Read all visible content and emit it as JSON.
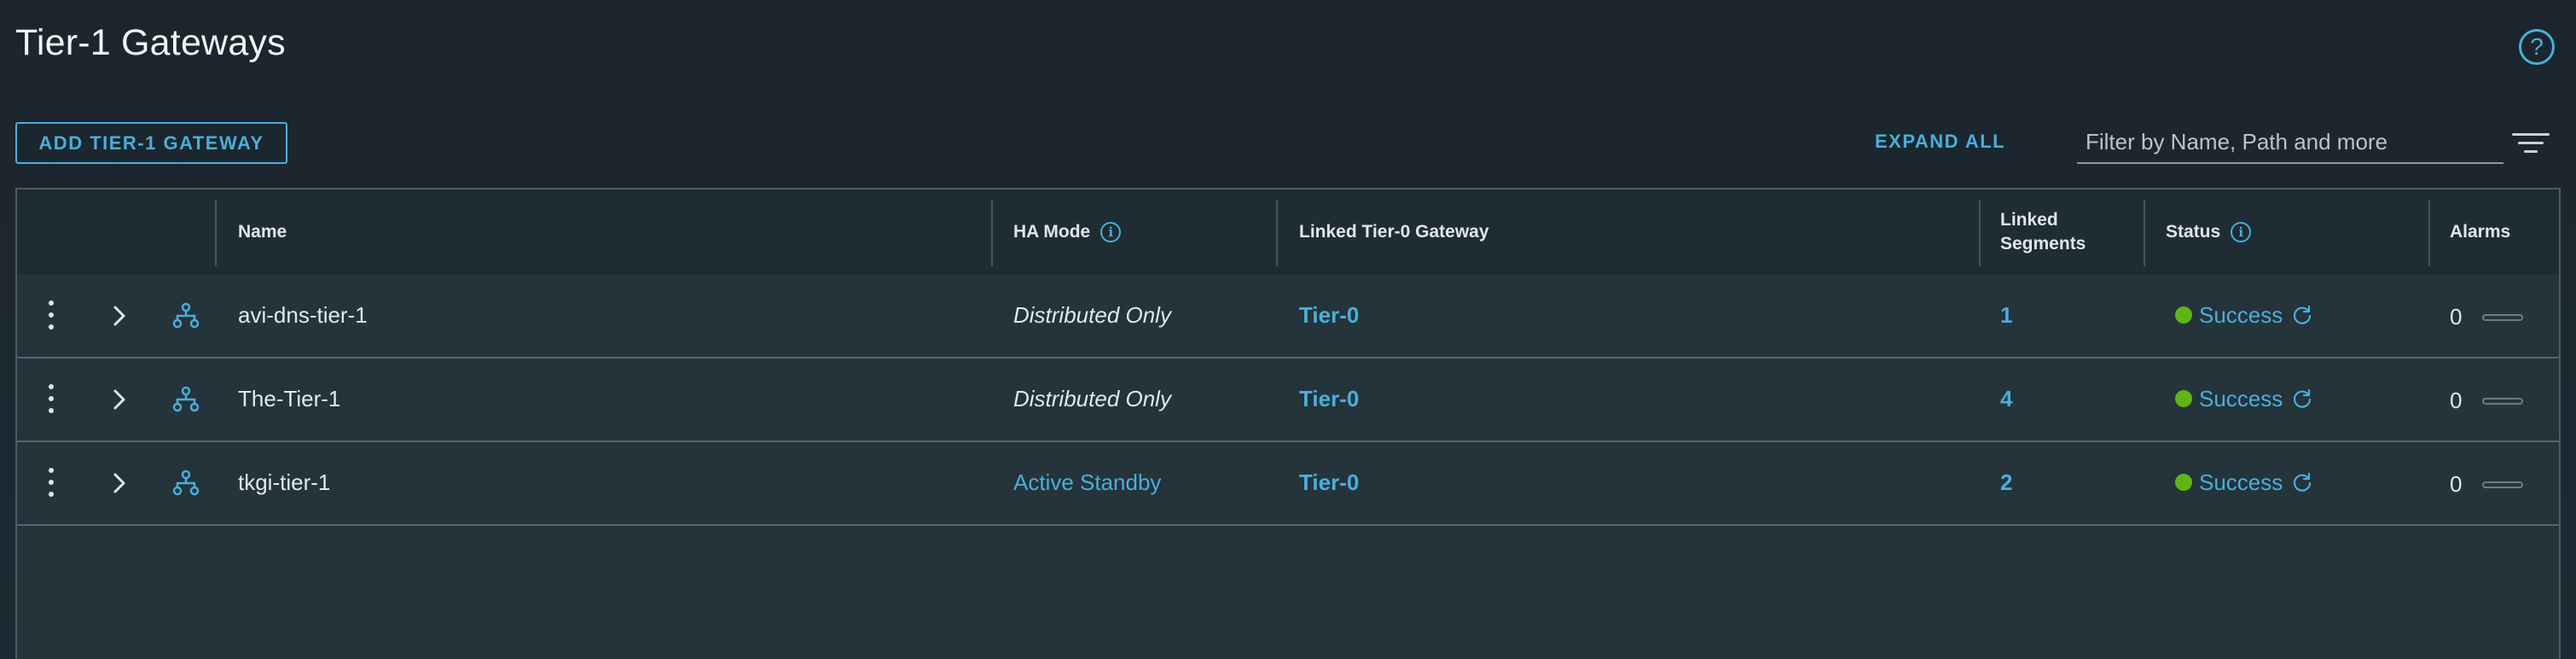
{
  "page": {
    "title": "Tier-1 Gateways",
    "help_icon": "help-circle-icon"
  },
  "toolbar": {
    "add_button_label": "ADD TIER-1 GATEWAY",
    "expand_all_label": "EXPAND ALL",
    "filter_placeholder": "Filter by Name, Path and more",
    "filter_icon": "filter-lines-icon"
  },
  "table": {
    "headers": {
      "name": "Name",
      "ha_mode": "HA Mode",
      "linked_tier0": "Linked Tier-0 Gateway",
      "linked_segments_line1": "Linked",
      "linked_segments_line2": "Segments",
      "status": "Status",
      "alarms": "Alarms"
    },
    "rows": [
      {
        "name": "avi-dns-tier-1",
        "ha_mode": "Distributed Only",
        "ha_is_link": false,
        "linked_tier0": "Tier-0",
        "linked_segments": "1",
        "status": "Success",
        "alarms": "0"
      },
      {
        "name": "The-Tier-1",
        "ha_mode": "Distributed Only",
        "ha_is_link": false,
        "linked_tier0": "Tier-0",
        "linked_segments": "4",
        "status": "Success",
        "alarms": "0"
      },
      {
        "name": "tkgi-tier-1",
        "ha_mode": "Active Standby",
        "ha_is_link": true,
        "linked_tier0": "Tier-0",
        "linked_segments": "2",
        "status": "Success",
        "alarms": "0"
      }
    ]
  },
  "colors": {
    "accent": "#49afd9",
    "success": "#60b515",
    "background": "#1d2a33"
  }
}
